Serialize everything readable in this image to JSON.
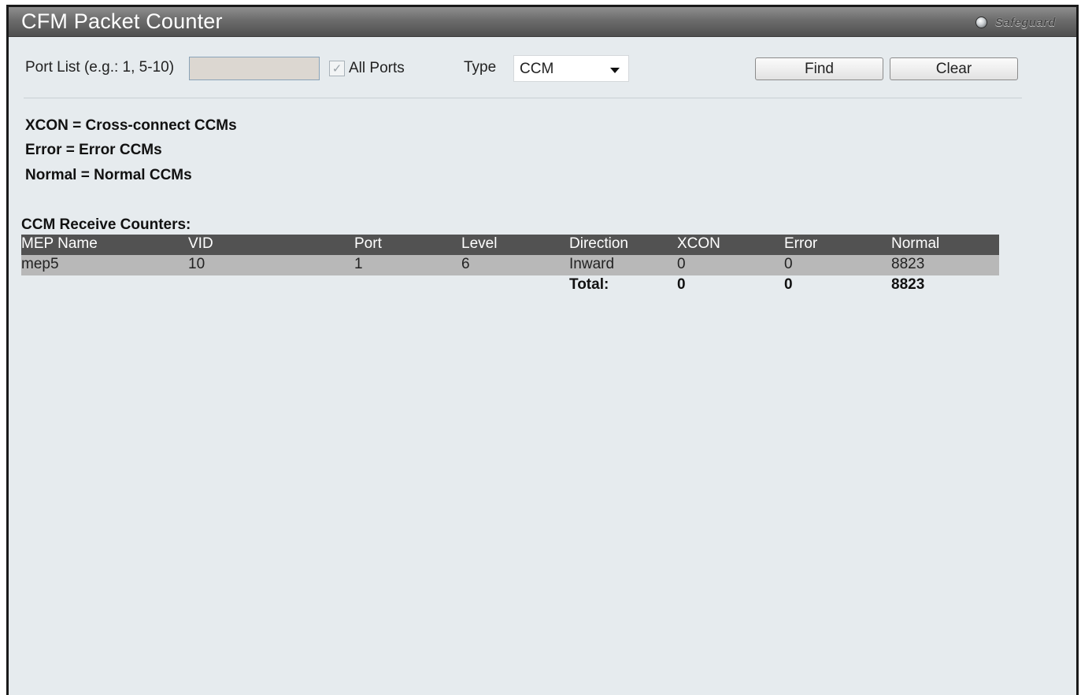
{
  "window": {
    "title": "CFM Packet Counter",
    "safeguard_label": "Safeguard",
    "safeguard_icon": "status-dot-icon"
  },
  "filter": {
    "port_list_label": "Port List (e.g.: 1, 5-10)",
    "port_list_value": "",
    "all_ports_label": "All Ports",
    "all_ports_checked": true,
    "type_label": "Type",
    "type_value": "CCM",
    "find_label": "Find",
    "clear_label": "Clear"
  },
  "legend": [
    "XCON = Cross-connect CCMs",
    "Error = Error CCMs",
    "Normal = Normal CCMs"
  ],
  "counters": {
    "title": "CCM Receive Counters:",
    "columns": [
      "MEP Name",
      "VID",
      "Port",
      "Level",
      "Direction",
      "XCON",
      "Error",
      "Normal"
    ],
    "rows": [
      [
        "mep5",
        "10",
        "1",
        "6",
        "Inward",
        "0",
        "0",
        "8823"
      ]
    ],
    "total": {
      "label": "Total:",
      "xcon": "0",
      "error": "0",
      "normal": "8823"
    }
  },
  "colors": {
    "title_bar": "#6c6c6c",
    "header_row": "#525252",
    "data_row": "#b8b8b8",
    "background": "#e6ebee"
  }
}
